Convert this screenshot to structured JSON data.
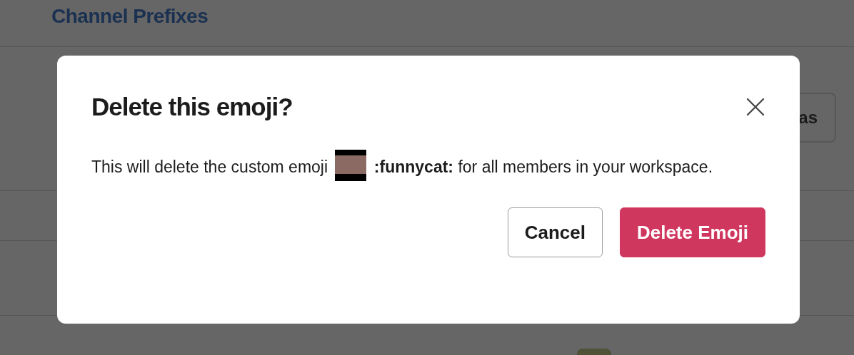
{
  "page": {
    "heading": "Channel Prefixes",
    "button_partial": "as"
  },
  "dialog": {
    "title": "Delete this emoji?",
    "message": [
      "This will delete the custom emoji",
      "**:funnycat:** for all members in your workspace."
    ],
    "buttons": [
      {
        "label": "Cancel",
        "kind": "secondary"
      },
      {
        "label": "Delete Emoji",
        "kind": "danger"
      }
    ]
  }
}
